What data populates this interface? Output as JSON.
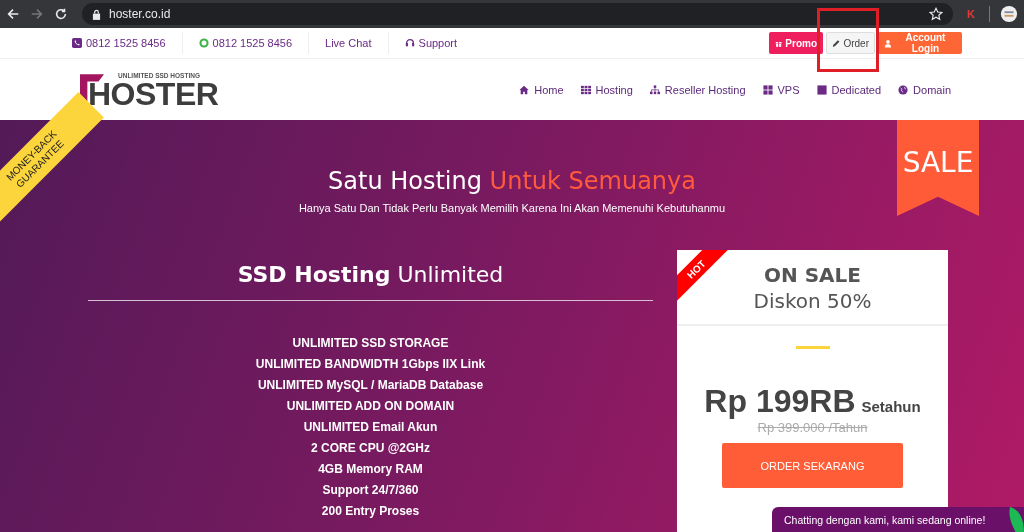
{
  "browser": {
    "url": "hoster.co.id",
    "extension": "K",
    "forward_disabled": true
  },
  "topbar": {
    "contacts": [
      {
        "kind": "phone",
        "label": "0812 1525 8456"
      },
      {
        "kind": "whatsapp",
        "label": "0812 1525 8456"
      },
      {
        "kind": "plain",
        "label": "Live Chat"
      },
      {
        "kind": "support",
        "label": "Support"
      }
    ],
    "buttons": [
      {
        "kind": "promo",
        "label": "Promo"
      },
      {
        "kind": "order",
        "label": "Order"
      },
      {
        "kind": "login",
        "label": "Account Login"
      }
    ]
  },
  "logo": {
    "tagline": "UNLIMITED SSD HOSTING",
    "name": "HOSTER"
  },
  "nav": [
    {
      "kind": "home",
      "label": "Home"
    },
    {
      "kind": "grid",
      "label": "Hosting"
    },
    {
      "kind": "sitemap",
      "label": "Reseller Hosting"
    },
    {
      "kind": "squares",
      "label": "VPS"
    },
    {
      "kind": "square",
      "label": "Dedicated"
    },
    {
      "kind": "globe",
      "label": "Domain"
    }
  ],
  "hero": {
    "corner_ribbon": [
      "MONEY-BACK",
      "GUARANTEE"
    ],
    "sale_ribbon": "SALE",
    "title": "Satu Hosting",
    "title_accent": "Untuk Semuanya",
    "subtitle": "Hanya Satu Dan Tidak Perlu Banyak Memilih Karena Ini Akan Memenuhi Kebutuhanmu"
  },
  "plan": {
    "title_bold": "SSD Hosting",
    "title_rest": "Unlimited",
    "features": [
      "UNLIMITED SSD STORAGE",
      "UNLIMITED BANDWIDTH 1Gbps IIX Link",
      "UNLIMITED MySQL / MariaDB Database",
      "UNLIMITED ADD ON DOMAIN",
      "UNLIMITED Email Akun",
      "2 CORE CPU @2GHz",
      "4GB Memory RAM",
      "Support 24/7/360",
      "200 Entry Proses"
    ]
  },
  "card": {
    "badge": "HOT",
    "title": "ON SALE",
    "subtitle": "Diskon 50%",
    "price": "Rp 199RB",
    "period": "Setahun",
    "old_price": "Rp 399.000 /Tahun",
    "button": "ORDER SEKARANG"
  },
  "chat": {
    "text": "Chatting dengan kami, kami sedang online!"
  }
}
